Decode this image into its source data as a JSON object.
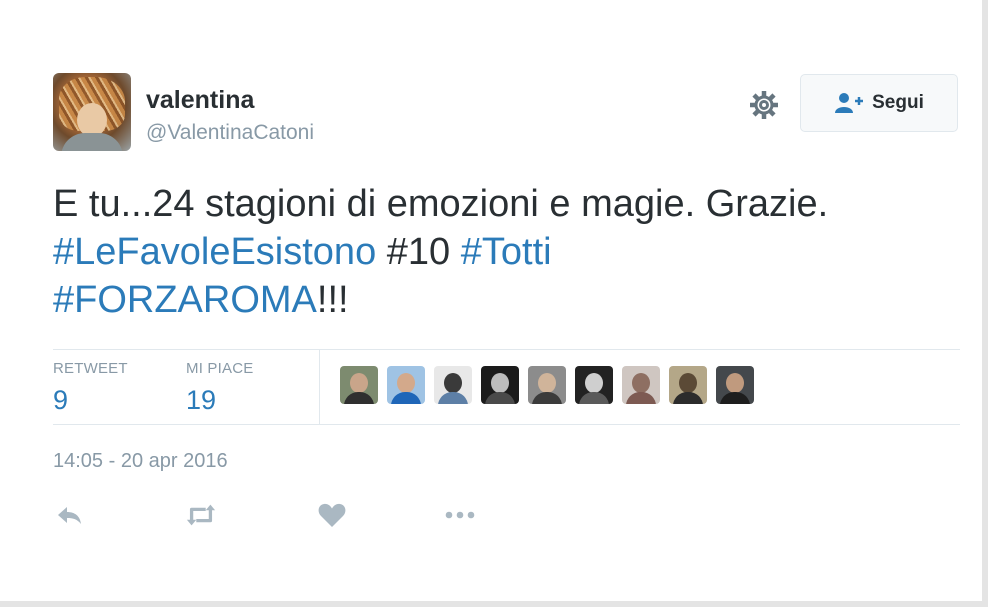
{
  "user": {
    "display_name": "valentina",
    "handle": "@ValentinaCatoni",
    "avatar_icon": "profile-photo"
  },
  "header": {
    "settings_icon": "gear-icon",
    "follow_label": "Segui",
    "follow_icon": "add-user-icon"
  },
  "tweet": {
    "line1": "E tu...24 stagioni di emozioni e magie. Grazie.",
    "hashtag1": "#LeFavoleEsistono",
    "text_between": " #10 ",
    "hashtag2": "#Totti",
    "hashtag3": "#FORZAROMA",
    "suffix": "!!!"
  },
  "stats": {
    "retweet_label": "RETWEET",
    "retweet_count": "9",
    "like_label": "MI PIACE",
    "like_count": "19"
  },
  "likers": [
    {
      "name": "liker-1"
    },
    {
      "name": "liker-2"
    },
    {
      "name": "liker-3"
    },
    {
      "name": "liker-4"
    },
    {
      "name": "liker-5"
    },
    {
      "name": "liker-6"
    },
    {
      "name": "liker-7"
    },
    {
      "name": "liker-8"
    },
    {
      "name": "liker-9"
    }
  ],
  "timestamp": "14:05 - 20 apr 2016",
  "actions": [
    "reply-icon",
    "retweet-icon",
    "like-icon",
    "more-icon"
  ],
  "colors": {
    "text": "#292f33",
    "muted": "#8899a6",
    "link": "#2b7bb9",
    "divider": "#e1e8ed"
  }
}
